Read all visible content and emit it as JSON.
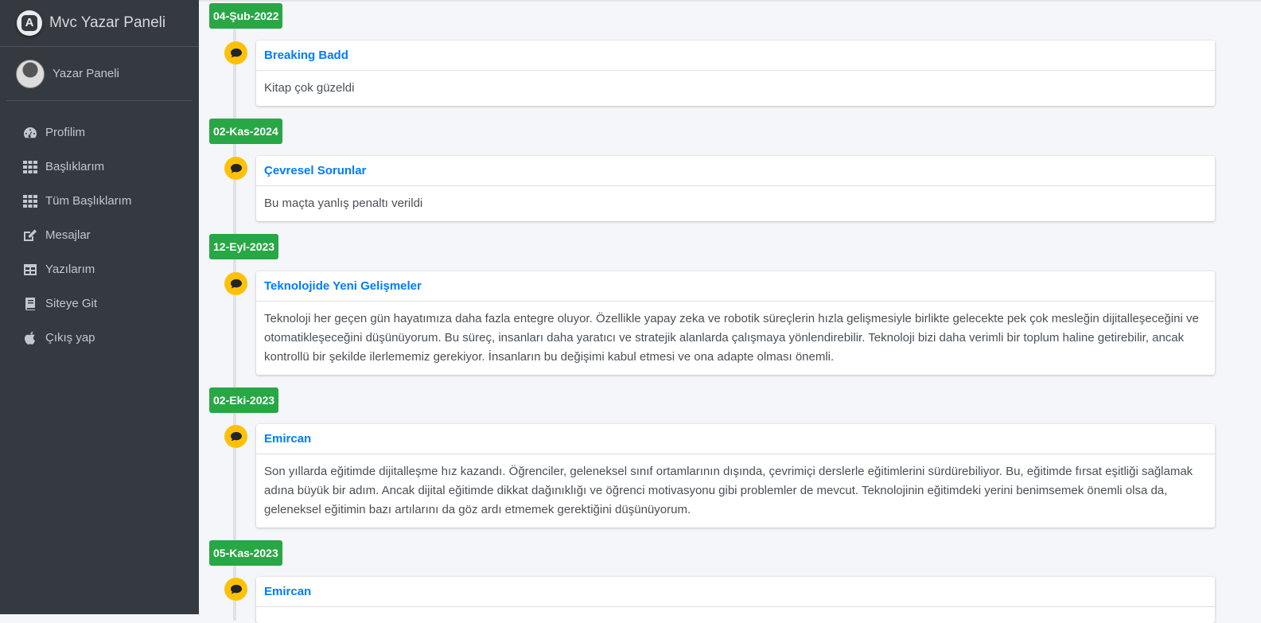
{
  "brand": {
    "title": "Mvc Yazar Paneli",
    "logo_letter": "A"
  },
  "user": {
    "name": "Yazar Paneli"
  },
  "nav": [
    {
      "label": "Profilim",
      "icon": "tachometer-icon"
    },
    {
      "label": "Başlıklarım",
      "icon": "grid-icon"
    },
    {
      "label": "Tüm Başlıklarım",
      "icon": "grid-icon"
    },
    {
      "label": "Mesajlar",
      "icon": "edit-icon"
    },
    {
      "label": "Yazılarım",
      "icon": "table-icon"
    },
    {
      "label": "Siteye Git",
      "icon": "book-icon"
    },
    {
      "label": "Çıkış yap",
      "icon": "apple-icon"
    }
  ],
  "timeline": [
    {
      "date": "04-Şub-2022",
      "title": "Breaking Badd",
      "body": "Kitap çok güzeldi"
    },
    {
      "date": "02-Kas-2024",
      "title": "Çevresel Sorunlar",
      "body": "Bu maçta yanlış penaltı verildi"
    },
    {
      "date": "12-Eyl-2023",
      "title": "Teknolojide Yeni Gelişmeler",
      "body": "Teknoloji her geçen gün hayatımıza daha fazla entegre oluyor. Özellikle yapay zeka ve robotik süreçlerin hızla gelişmesiyle birlikte gelecekte pek çok mesleğin dijitalleşeceğini ve otomatikleşeceğini düşünüyorum. Bu süreç, insanları daha yaratıcı ve stratejik alanlarda çalışmaya yönlendirebilir. Teknoloji bizi daha verimli bir toplum haline getirebilir, ancak kontrollü bir şekilde ilerlememiz gerekiyor. İnsanların bu değişimi kabul etmesi ve ona adapte olması önemli."
    },
    {
      "date": "02-Eki-2023",
      "title": "Emircan",
      "body": "Son yıllarda eğitimde dijitalleşme hız kazandı. Öğrenciler, geleneksel sınıf ortamlarının dışında, çevrimiçi derslerle eğitimlerini sürdürebiliyor. Bu, eğitimde fırsat eşitliği sağlamak adına büyük bir adım. Ancak dijital eğitimde dikkat dağınıklığı ve öğrenci motivasyonu gibi problemler de mevcut. Teknolojinin eğitimdeki yerini benimsemek önemli olsa da, geleneksel eğitimin bazı artılarını da göz ardı etmemek gerektiğini düşünüyorum."
    },
    {
      "date": "05-Kas-2023",
      "title": "Emircan",
      "body": ""
    }
  ],
  "colors": {
    "sidebar": "#343a40",
    "label": "#28a745",
    "icon": "#ffc107",
    "link": "#007bff"
  }
}
